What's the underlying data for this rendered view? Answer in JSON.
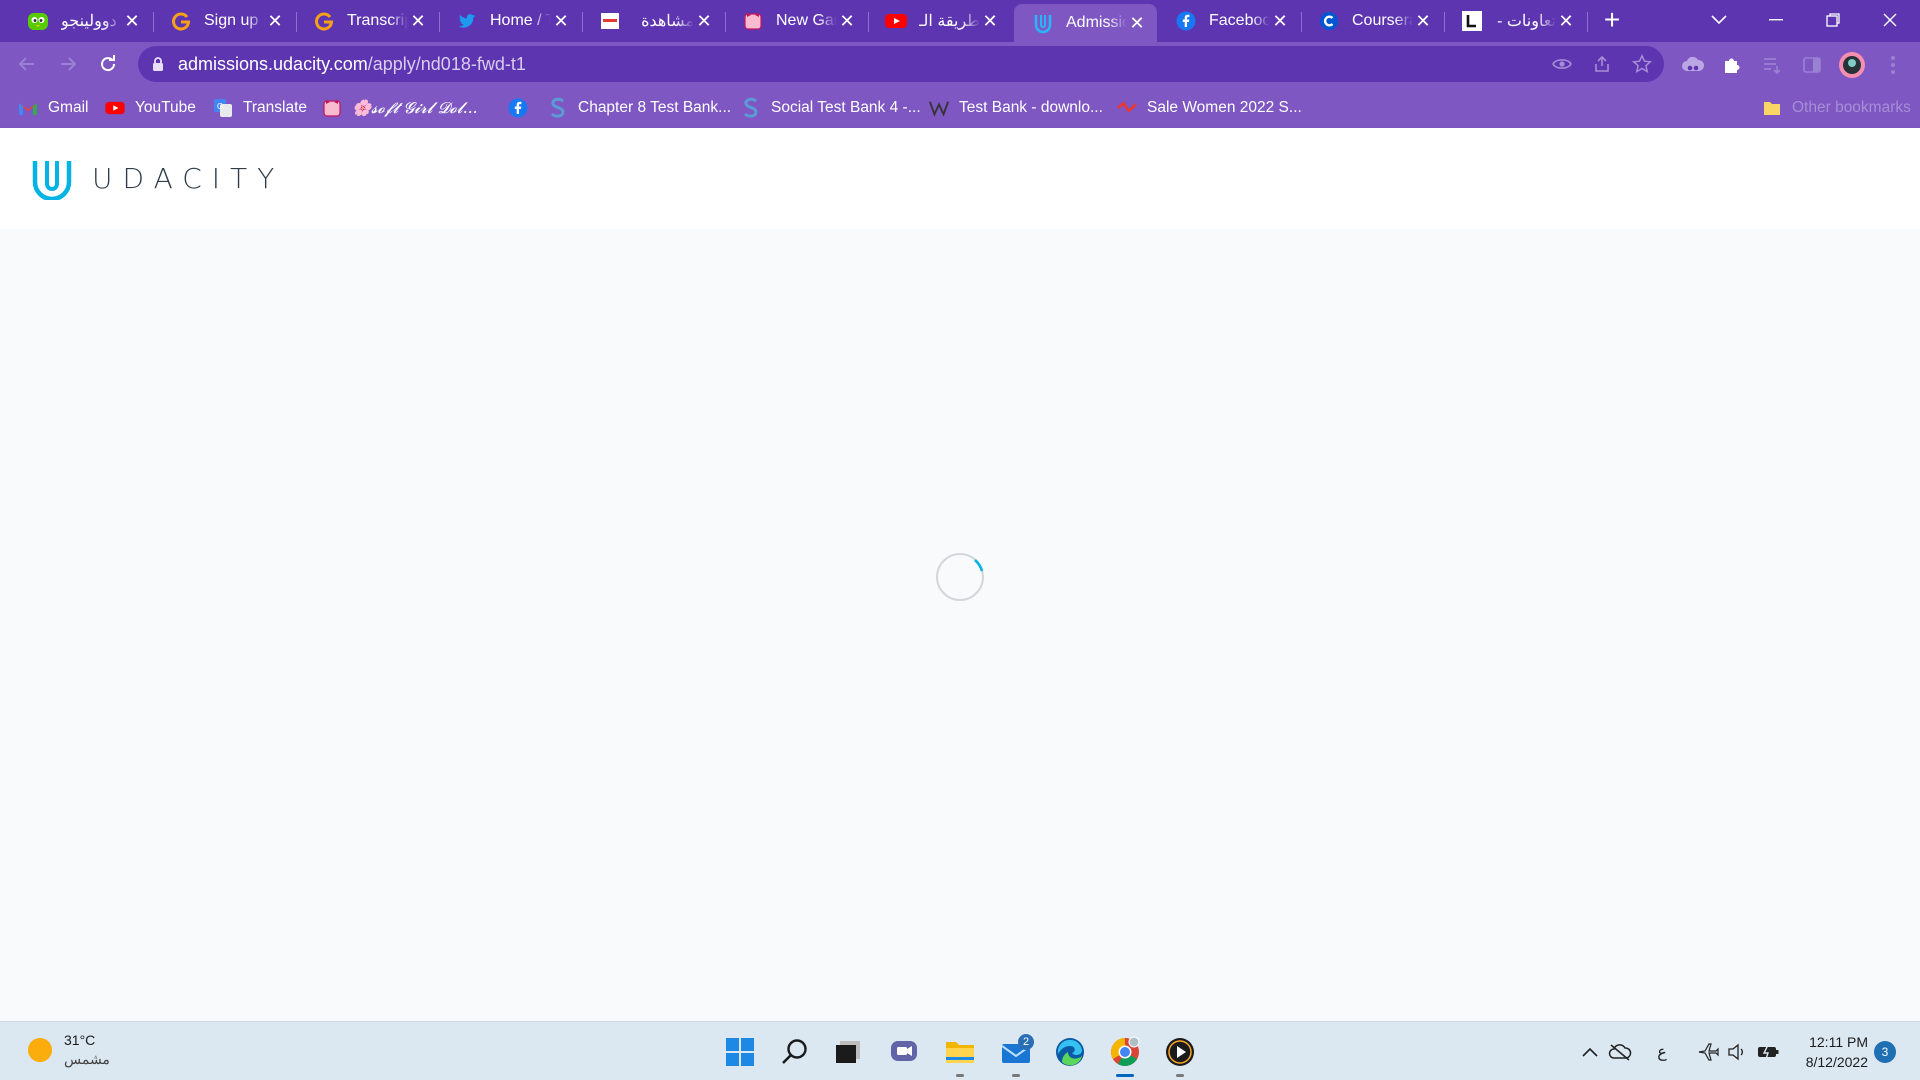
{
  "browser": {
    "tabs": [
      {
        "title": "دوولينجو",
        "favicon": "duolingo-icon",
        "color": "#58cc02"
      },
      {
        "title": "Sign up |",
        "favicon": "google-g-icon",
        "color": "#f4a019"
      },
      {
        "title": "Transcript",
        "favicon": "google-g-icon",
        "color": "#f4a019"
      },
      {
        "title": "Home / T",
        "favicon": "twitter-icon",
        "color": "#1d9bf0"
      },
      {
        "title": "مشاهدة",
        "favicon": "site-icon",
        "color": "#ffffff"
      },
      {
        "title": "New Gam",
        "favicon": "kitty-icon",
        "color": "#f48fb1"
      },
      {
        "title": "طريقة الـ",
        "favicon": "youtube-icon",
        "color": "#ff0000"
      },
      {
        "title": "Admissio",
        "favicon": "udacity-icon",
        "color": "#02b3e4",
        "active": true
      },
      {
        "title": "Facebook",
        "favicon": "facebook-icon",
        "color": "#1877f2"
      },
      {
        "title": "Coursera",
        "favicon": "coursera-icon",
        "color": "#0056d2"
      },
      {
        "title": "تعاونات -",
        "favicon": "letter-l-icon",
        "color": "#ffffff"
      }
    ],
    "url_host": "admissions.udacity.com",
    "url_path": "/apply/nd018-fwd-t1",
    "bookmarks": [
      {
        "label": "Gmail",
        "icon": "gmail-icon"
      },
      {
        "label": "YouTube",
        "icon": "youtube-icon"
      },
      {
        "label": "Translate",
        "icon": "translate-icon"
      },
      {
        "label": "🌸𝓼𝓸𝓯𝓽 𝓖𝓲𝓻𝓵 𝓓𝓸𝓵...",
        "icon": "kitty-icon"
      },
      {
        "label": "",
        "icon": "facebook-icon"
      },
      {
        "label": "Chapter 8 Test Bank...",
        "icon": "s-icon"
      },
      {
        "label": "Social Test Bank 4 -...",
        "icon": "s-icon"
      },
      {
        "label": "Test Bank - downlo...",
        "icon": "w-icon"
      },
      {
        "label": "Sale Women 2022 S...",
        "icon": "shop-icon"
      }
    ],
    "other_bookmarks": "Other bookmarks"
  },
  "page": {
    "logo_text": "UDACITY",
    "loading": true
  },
  "taskbar": {
    "weather_temp": "31°C",
    "weather_desc": "مشمس",
    "mail_badge": "2",
    "input_lang": "ع",
    "time": "12:11 PM",
    "date": "8/12/2022",
    "notification_count": "3"
  },
  "colors": {
    "chrome_dark": "#5e35b1",
    "chrome_light": "#7e57c2",
    "udacity_blue": "#02b3e4",
    "page_bg": "#f9fafb"
  }
}
